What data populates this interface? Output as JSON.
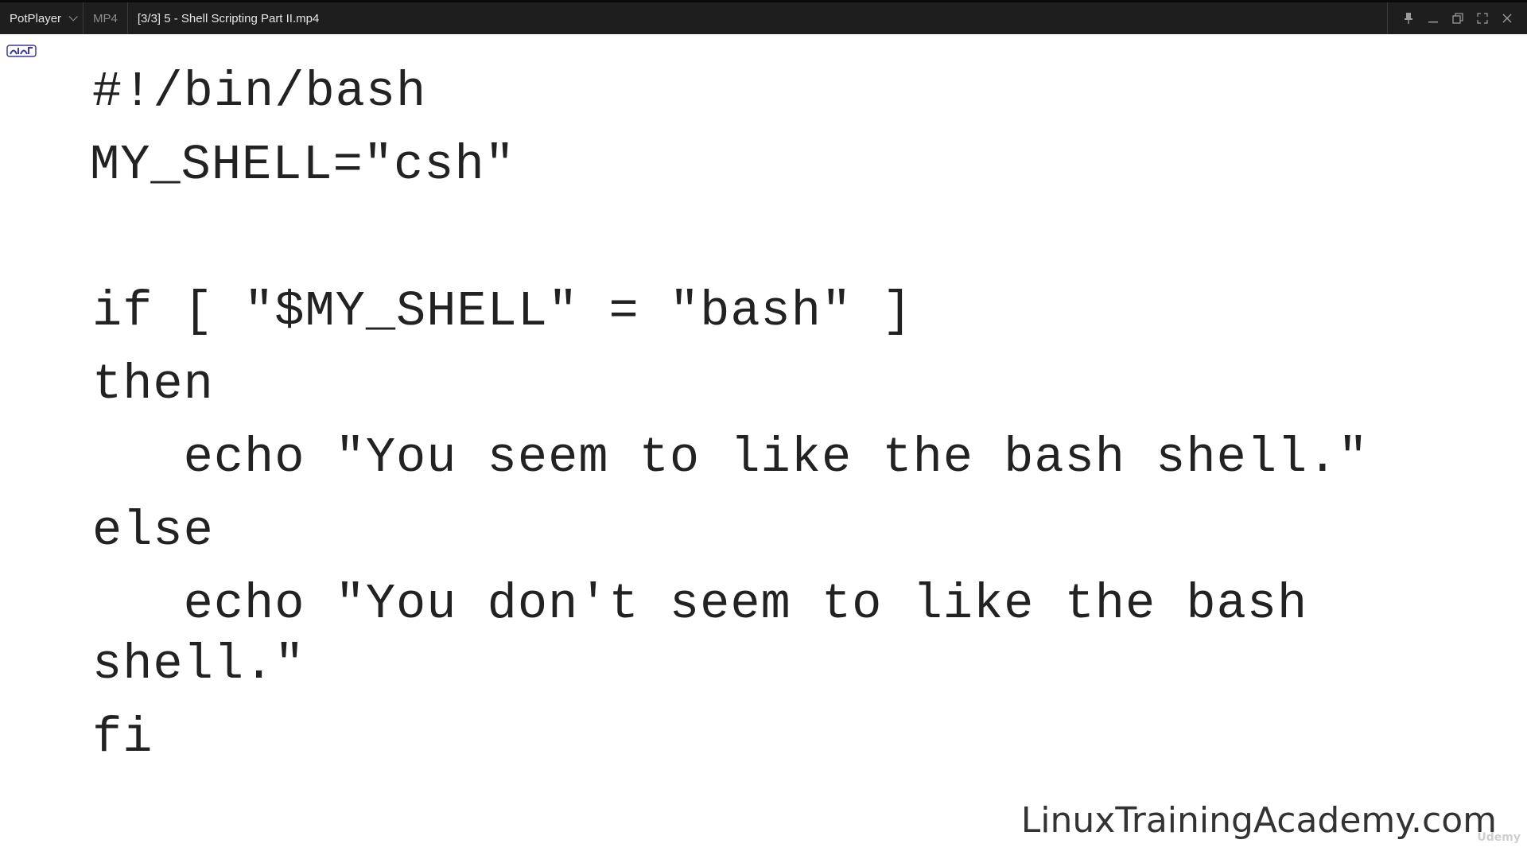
{
  "titlebar": {
    "app_name": "PotPlayer",
    "format": "MP4",
    "file_title": "[3/3] 5 - Shell Scripting Part II.mp4",
    "buttons": [
      "pin-icon",
      "minimize-icon",
      "restore-icon",
      "fullscreen-icon",
      "close-icon"
    ]
  },
  "video": {
    "code_lines": [
      "#!/bin/bash",
      "MY_SHELL=\"csh\"",
      "if [ \"$MY_SHELL\" = \"bash\" ]",
      "then",
      "   echo \"You seem to like the bash shell.\"",
      "else",
      "   echo \"You don't seem to like the bash",
      "shell.\"",
      "fi"
    ],
    "watermark": "LinuxTrainingAcademy.com",
    "corner_badge": "Udemy"
  },
  "colors": {
    "titlebar_bg": "#1e1e1e",
    "video_bg": "#ffffff",
    "code_text": "#222222"
  }
}
